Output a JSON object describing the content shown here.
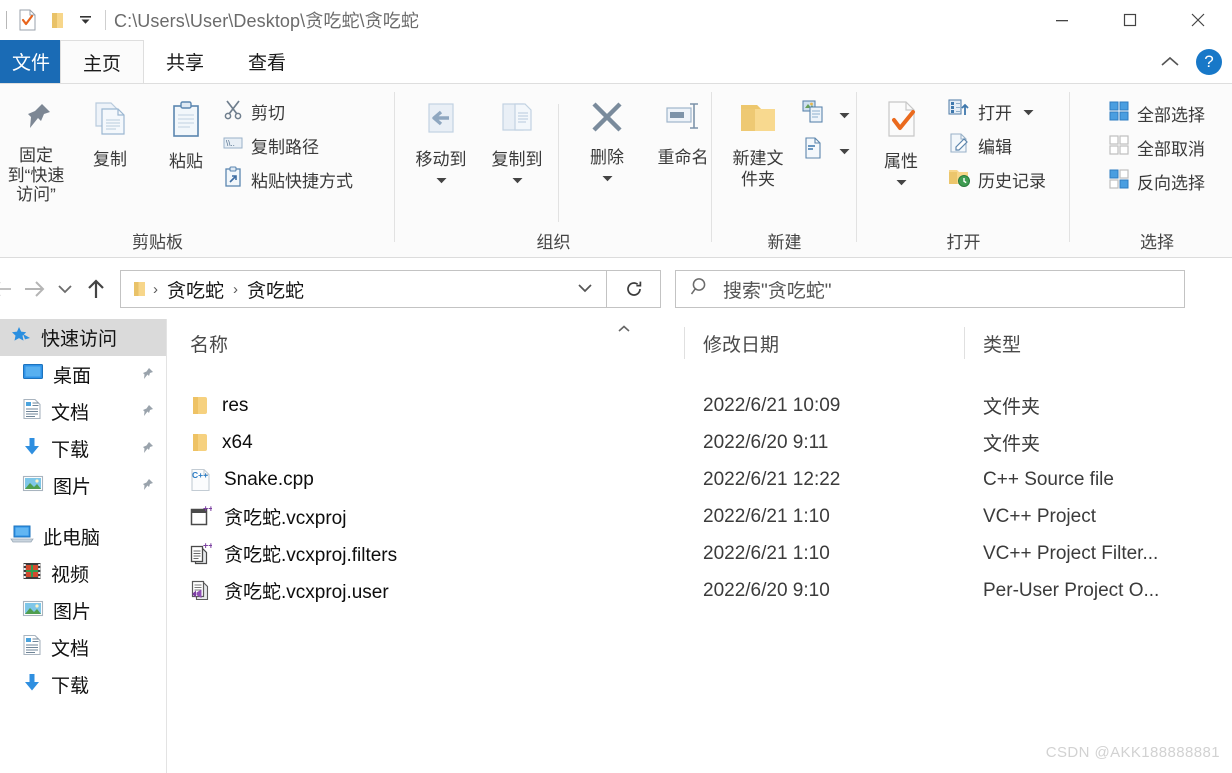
{
  "window": {
    "path_title": "C:\\Users\\User\\Desktop\\贪吃蛇\\贪吃蛇",
    "minimize_label": "—",
    "maximize_label": "▢",
    "close_label": "✕"
  },
  "quick_access_toolbar": {
    "properties_label": "属性",
    "new_folder_label": "新建文件夹",
    "customize_label": "自定义快速访问工具栏"
  },
  "ribbon_tabs": [
    {
      "label": "文件",
      "active": false,
      "kind": "file"
    },
    {
      "label": "主页",
      "active": true,
      "kind": "normal"
    },
    {
      "label": "共享",
      "active": false,
      "kind": "normal"
    },
    {
      "label": "查看",
      "active": false,
      "kind": "normal"
    }
  ],
  "ribbon_right": {
    "collapse_label": "折叠功能区",
    "help_label": "?"
  },
  "ribbon_groups": [
    {
      "name": "clipboard",
      "label": "剪贴板",
      "big_buttons": [
        {
          "label": "固定到“快速访问”",
          "icon": "pin-icon"
        },
        {
          "label": "复制",
          "icon": "copy-icon"
        },
        {
          "label": "粘贴",
          "icon": "paste-icon"
        }
      ],
      "small_buttons": [
        {
          "label": "剪切",
          "icon": "scissors-icon"
        },
        {
          "label": "复制路径",
          "icon": "copy-path-icon"
        },
        {
          "label": "粘贴快捷方式",
          "icon": "paste-shortcut-icon"
        }
      ]
    },
    {
      "name": "organize",
      "label": "组织",
      "big_buttons": [
        {
          "label": "移动到",
          "icon": "move-to-icon",
          "has_dropdown": true
        },
        {
          "label": "复制到",
          "icon": "copy-to-icon",
          "has_dropdown": true
        },
        {
          "label": "删除",
          "icon": "delete-icon",
          "has_dropdown": true
        },
        {
          "label": "重命名",
          "icon": "rename-icon",
          "has_dropdown": false
        }
      ]
    },
    {
      "name": "new",
      "label": "新建",
      "big_buttons": [
        {
          "label": "新建文件夹",
          "icon": "new-folder-icon"
        }
      ],
      "small_buttons": [
        {
          "label": "",
          "icon": "new-item-icon",
          "has_dropdown": true
        },
        {
          "label": "",
          "icon": "easy-access-icon",
          "has_dropdown": true
        }
      ]
    },
    {
      "name": "open",
      "label": "打开",
      "big_buttons": [
        {
          "label": "属性",
          "icon": "properties-icon",
          "has_dropdown": true
        }
      ],
      "small_buttons": [
        {
          "label": "打开",
          "icon": "open-icon",
          "has_dropdown": true
        },
        {
          "label": "编辑",
          "icon": "edit-icon"
        },
        {
          "label": "历史记录",
          "icon": "history-icon"
        }
      ]
    },
    {
      "name": "select",
      "label": "选择",
      "small_buttons": [
        {
          "label": "全部选择",
          "icon": "select-all-icon"
        },
        {
          "label": "全部取消",
          "icon": "select-none-icon"
        },
        {
          "label": "反向选择",
          "icon": "invert-selection-icon"
        }
      ]
    }
  ],
  "navigation": {
    "back_label": "后退",
    "forward_label": "前进",
    "recent_label": "最近浏览的位置",
    "up_label": "上移到“贪吃蛇”",
    "refresh_label": "刷新“贪吃蛇”",
    "breadcrumbs": [
      "贪吃蛇",
      "贪吃蛇"
    ],
    "breadcrumb_separator": "›",
    "dropdown_label": "以前的位置"
  },
  "search": {
    "placeholder": "搜索\"贪吃蛇\"",
    "icon": "search-icon"
  },
  "sidebar": {
    "items": [
      {
        "label": "快速访问",
        "icon": "star-pin-icon",
        "level": "root",
        "selected": true,
        "pinned": false
      },
      {
        "label": "桌面",
        "icon": "desktop-icon",
        "level": "child",
        "selected": false,
        "pinned": true
      },
      {
        "label": "文档",
        "icon": "documents-icon",
        "level": "child",
        "selected": false,
        "pinned": true
      },
      {
        "label": "下载",
        "icon": "downloads-icon",
        "level": "child",
        "selected": false,
        "pinned": true
      },
      {
        "label": "图片",
        "icon": "pictures-icon",
        "level": "child",
        "selected": false,
        "pinned": true
      },
      {
        "label": "此电脑",
        "icon": "this-pc-icon",
        "level": "root",
        "selected": false,
        "pinned": false
      },
      {
        "label": "视频",
        "icon": "videos-icon",
        "level": "child",
        "selected": false,
        "pinned": false
      },
      {
        "label": "图片",
        "icon": "pictures-icon",
        "level": "child",
        "selected": false,
        "pinned": false
      },
      {
        "label": "文档",
        "icon": "documents-icon",
        "level": "child",
        "selected": false,
        "pinned": false
      },
      {
        "label": "下载",
        "icon": "downloads-icon",
        "level": "child",
        "selected": false,
        "pinned": false
      }
    ]
  },
  "file_list": {
    "columns": [
      {
        "key": "name",
        "label": "名称",
        "sorted": "asc"
      },
      {
        "key": "date",
        "label": "修改日期",
        "sorted": ""
      },
      {
        "key": "type",
        "label": "类型",
        "sorted": ""
      }
    ],
    "sort_caret": "⌃",
    "rows": [
      {
        "name": "res",
        "date": "2022/6/21 10:09",
        "type": "文件夹",
        "icon": "folder-icon"
      },
      {
        "name": "x64",
        "date": "2022/6/20 9:11",
        "type": "文件夹",
        "icon": "folder-icon"
      },
      {
        "name": "Snake.cpp",
        "date": "2022/6/21 12:22",
        "type": "C++ Source file",
        "icon": "cpp-source-icon"
      },
      {
        "name": "贪吃蛇.vcxproj",
        "date": "2022/6/21 1:10",
        "type": "VC++ Project",
        "icon": "vcxproj-icon"
      },
      {
        "name": "贪吃蛇.vcxproj.filters",
        "date": "2022/6/21 1:10",
        "type": "VC++ Project Filter...",
        "icon": "vcxproj-filters-icon"
      },
      {
        "name": "贪吃蛇.vcxproj.user",
        "date": "2022/6/20 9:10",
        "type": "Per-User Project O...",
        "icon": "vcxproj-user-icon"
      }
    ]
  },
  "watermark": {
    "text": "CSDN @AKK188888881"
  },
  "colors": {
    "accent_blue": "#1a6bb5",
    "help_blue": "#1878c8",
    "folder_yellow": "#f6d17f",
    "selection_gray": "#dadada",
    "ribbon_bg": "#fbfbfb"
  }
}
